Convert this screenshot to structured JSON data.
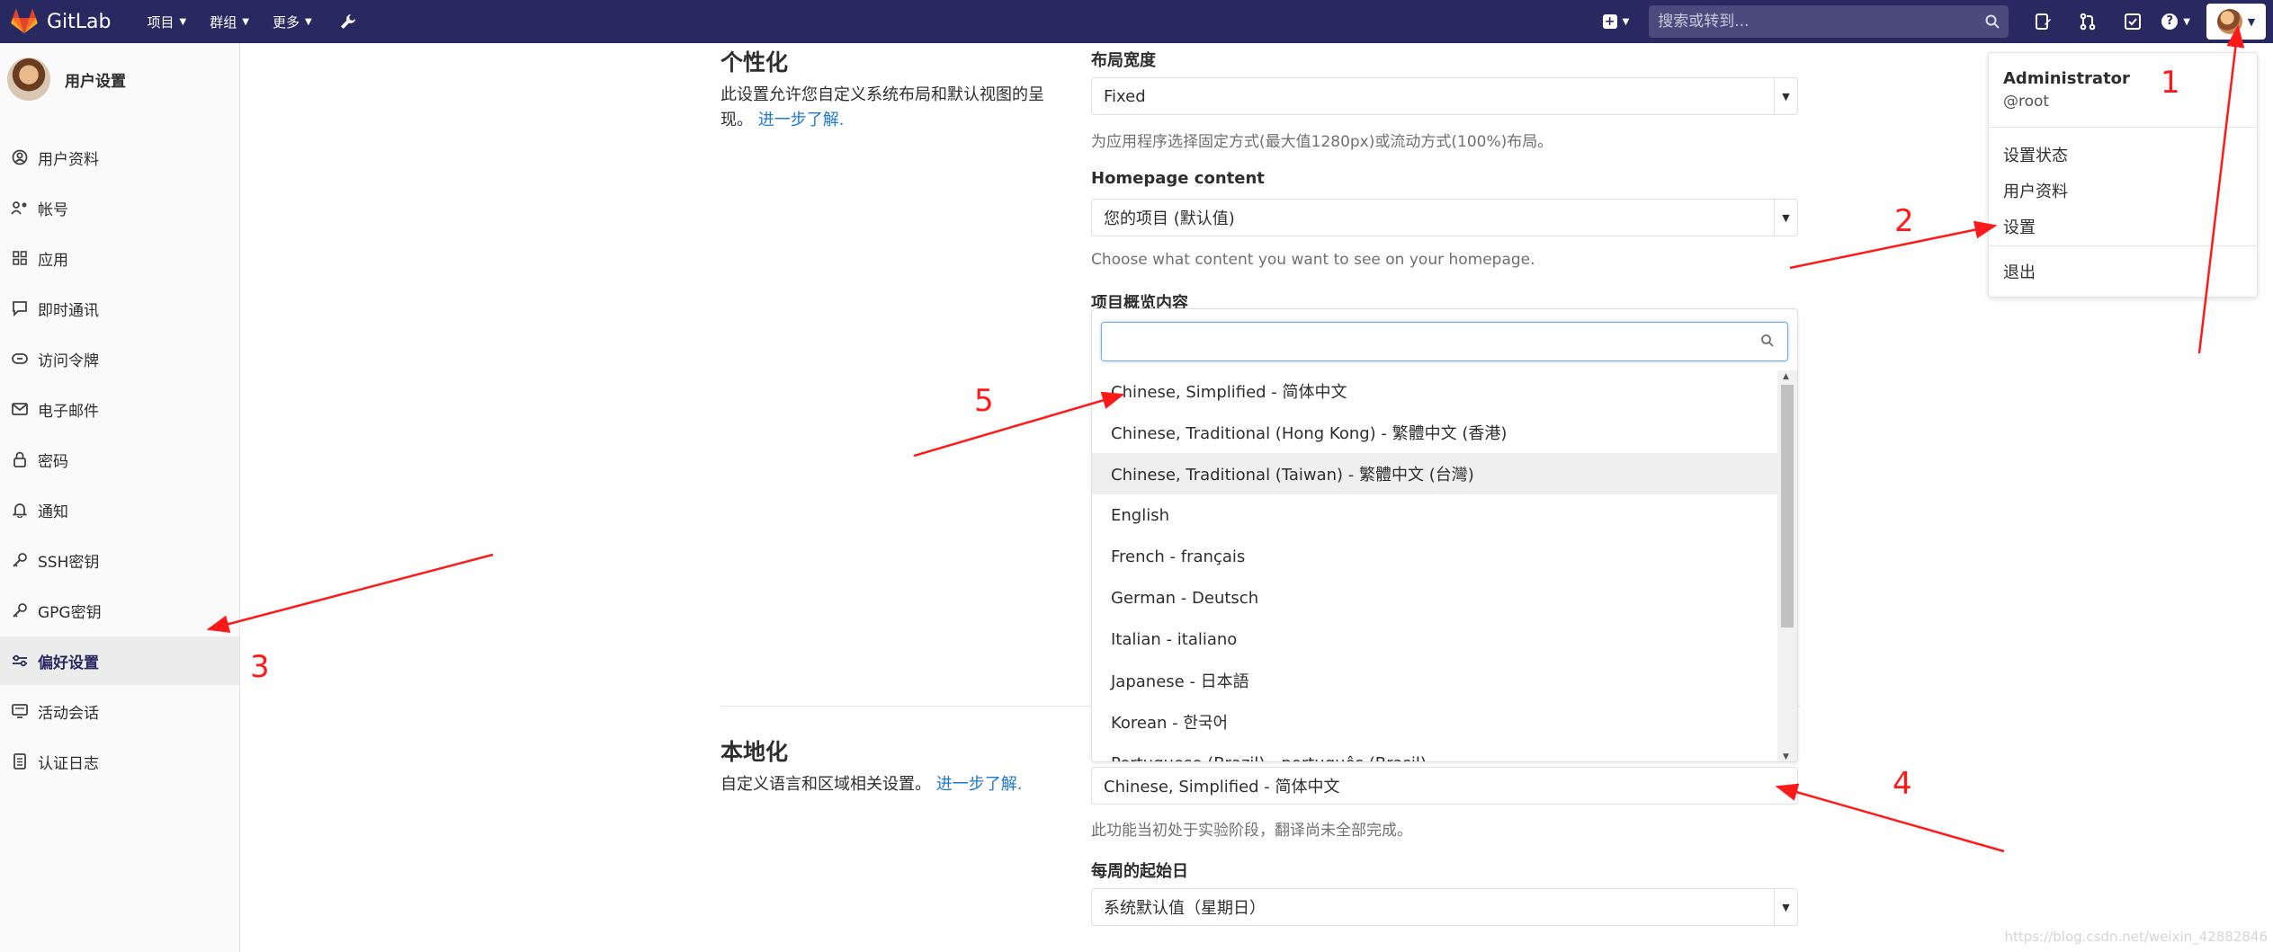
{
  "nav": {
    "brand": "GitLab",
    "links": [
      {
        "label": "项目"
      },
      {
        "label": "群组"
      },
      {
        "label": "更多"
      }
    ],
    "search_placeholder": "搜索或转到..."
  },
  "sidebar": {
    "title": "用户设置",
    "items": [
      {
        "label": "用户资料",
        "icon": "user-icon"
      },
      {
        "label": "帐号",
        "icon": "account-icon"
      },
      {
        "label": "应用",
        "icon": "grid-icon"
      },
      {
        "label": "即时通讯",
        "icon": "chat-icon"
      },
      {
        "label": "访问令牌",
        "icon": "token-icon"
      },
      {
        "label": "电子邮件",
        "icon": "mail-icon"
      },
      {
        "label": "密码",
        "icon": "lock-icon"
      },
      {
        "label": "通知",
        "icon": "bell-icon"
      },
      {
        "label": "SSH密钥",
        "icon": "key-icon"
      },
      {
        "label": "GPG密钥",
        "icon": "key-icon"
      },
      {
        "label": "偏好设置",
        "icon": "sliders-icon",
        "active": true
      },
      {
        "label": "活动会话",
        "icon": "monitor-icon"
      },
      {
        "label": "认证日志",
        "icon": "log-icon"
      }
    ]
  },
  "personalize": {
    "title": "个性化",
    "desc": "此设置允许您自定义系统布局和默认视图的呈现。",
    "learn_more": "进一步了解.",
    "layout_width_label": "布局宽度",
    "layout_width_value": "Fixed",
    "layout_width_help": "为应用程序选择固定方式(最大值1280px)或流动方式(100%)布局。",
    "homepage_label": "Homepage content",
    "homepage_value": "您的项目 (默认值)",
    "homepage_help": "Choose what content you want to see on your homepage.",
    "overview_label": "项目概览内容"
  },
  "language_dropdown": {
    "options": [
      "Chinese, Simplified - 简体中文",
      "Chinese, Traditional (Hong Kong) - 繁體中文 (香港)",
      "Chinese, Traditional (Taiwan) - 繁體中文 (台灣)",
      "English",
      "French - français",
      "German - Deutsch",
      "Italian - italiano",
      "Japanese - 日本語",
      "Korean - 한국어",
      "Portuguese (Brazil) - português (Brasil)"
    ],
    "highlighted_index": 2
  },
  "localization": {
    "title": "本地化",
    "desc": "自定义语言和区域相关设置。",
    "learn_more": "进一步了解.",
    "language_value": "Chinese, Simplified - 简体中文",
    "language_help": "此功能当初处于实验阶段，翻译尚未全部完成。",
    "first_day_label": "每周的起始日",
    "first_day_value": "系统默认值（星期日）"
  },
  "user_menu": {
    "name": "Administrator",
    "handle": "@root",
    "items": [
      "设置状态",
      "用户资料",
      "设置"
    ],
    "signout": "退出"
  },
  "annotations": [
    "1",
    "2",
    "3",
    "4",
    "5"
  ],
  "watermark": "https://blog.csdn.net/weixin_42882846",
  "colors": {
    "nav_bg": "#292961",
    "arrow": "#ff1a1a",
    "link": "#1f78d1"
  }
}
